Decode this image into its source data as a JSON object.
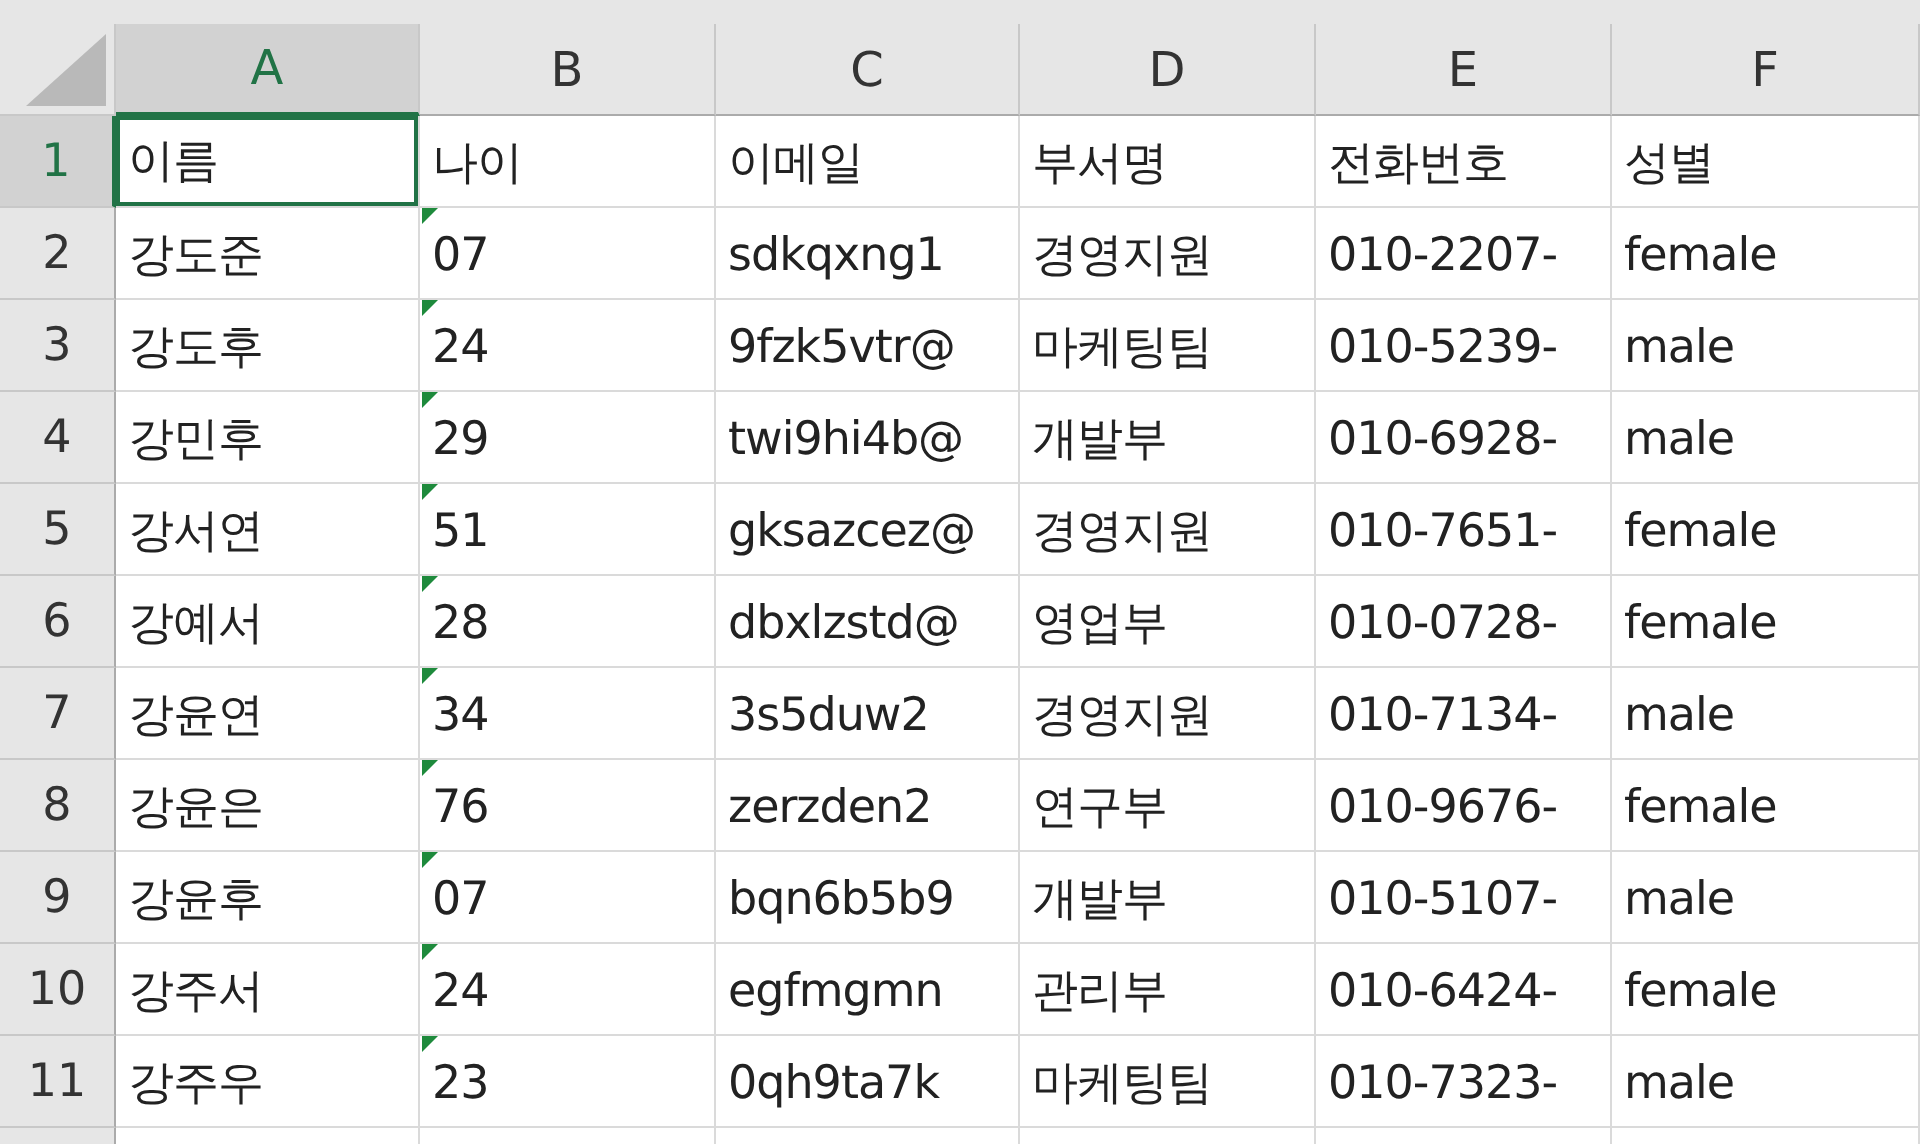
{
  "columns": [
    {
      "label": "A",
      "selected": true
    },
    {
      "label": "B",
      "selected": false
    },
    {
      "label": "C",
      "selected": false
    },
    {
      "label": "D",
      "selected": false
    },
    {
      "label": "E",
      "selected": false
    },
    {
      "label": "F",
      "selected": false
    }
  ],
  "rows": [
    {
      "number": "1",
      "selected": true,
      "number_as_text": false,
      "cells": [
        "이름",
        "나이",
        "이메일",
        "부서명",
        "전화번호",
        "성별"
      ]
    },
    {
      "number": "2",
      "selected": false,
      "number_as_text": true,
      "cells": [
        "강도준",
        "07",
        "sdkqxng1",
        "경영지원",
        "010-2207-",
        "female"
      ]
    },
    {
      "number": "3",
      "selected": false,
      "number_as_text": true,
      "cells": [
        "강도후",
        "24",
        "9fzk5vtr@",
        "마케팅팀",
        "010-5239-",
        "male"
      ]
    },
    {
      "number": "4",
      "selected": false,
      "number_as_text": true,
      "cells": [
        "강민후",
        "29",
        "twi9hi4b@",
        "개발부",
        "010-6928-",
        "male"
      ]
    },
    {
      "number": "5",
      "selected": false,
      "number_as_text": true,
      "cells": [
        "강서연",
        "51",
        "gksazcez@",
        "경영지원",
        "010-7651-",
        "female"
      ]
    },
    {
      "number": "6",
      "selected": false,
      "number_as_text": true,
      "cells": [
        "강예서",
        "28",
        "dbxlzstd@",
        "영업부",
        "010-0728-",
        "female"
      ]
    },
    {
      "number": "7",
      "selected": false,
      "number_as_text": true,
      "cells": [
        "강윤연",
        "34",
        "3s5duw2",
        "경영지원",
        "010-7134-",
        "male"
      ]
    },
    {
      "number": "8",
      "selected": false,
      "number_as_text": true,
      "cells": [
        "강윤은",
        "76",
        "zerzden2",
        "연구부",
        "010-9676-",
        "female"
      ]
    },
    {
      "number": "9",
      "selected": false,
      "number_as_text": true,
      "cells": [
        "강윤후",
        "07",
        "bqn6b5b9",
        "개발부",
        "010-5107-",
        "male"
      ]
    },
    {
      "number": "10",
      "selected": false,
      "number_as_text": true,
      "cells": [
        "강주서",
        "24",
        "egfmgmn",
        "관리부",
        "010-6424-",
        "female"
      ]
    },
    {
      "number": "11",
      "selected": false,
      "number_as_text": true,
      "cells": [
        "강주우",
        "23",
        "0qh9ta7k",
        "마케팅팀",
        "010-7323-",
        "male"
      ]
    }
  ]
}
